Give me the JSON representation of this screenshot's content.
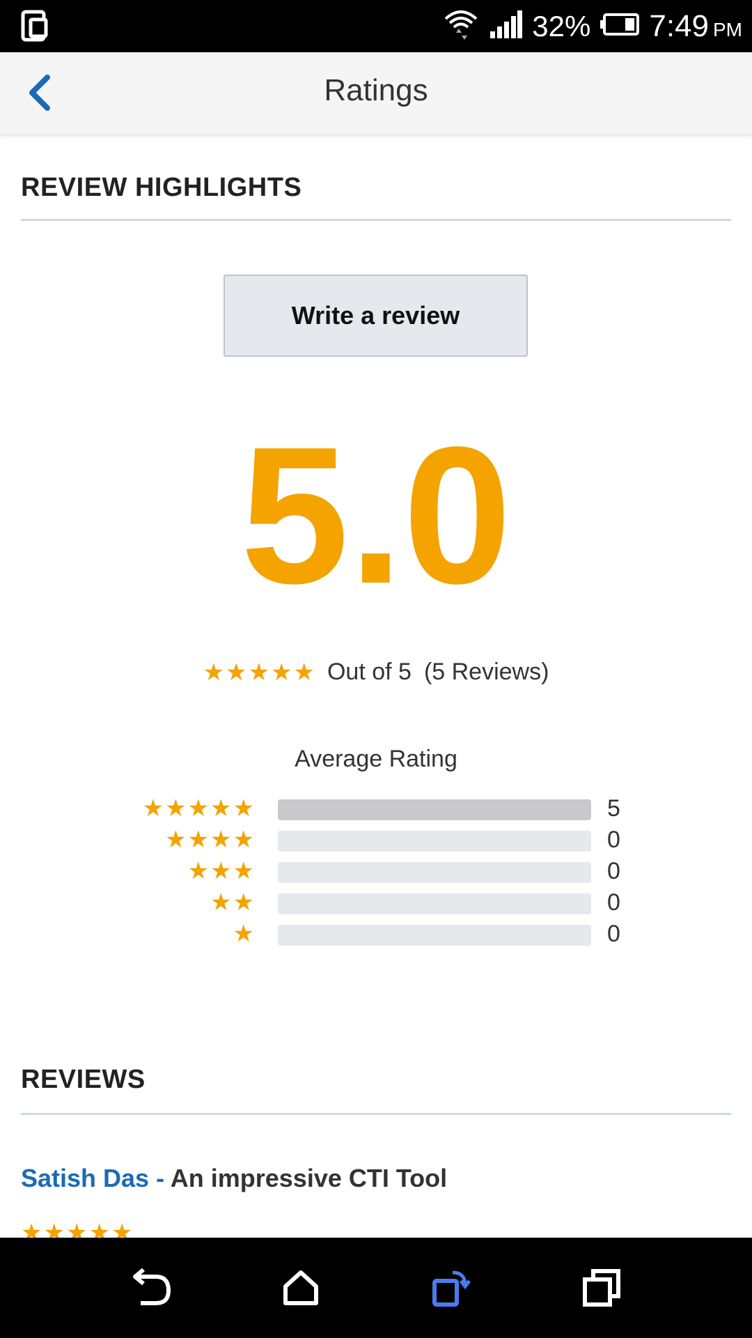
{
  "status_bar": {
    "battery": "32%",
    "time": "7:49",
    "ampm": "PM"
  },
  "app_bar": {
    "title": "Ratings"
  },
  "highlights": {
    "section_title": "REVIEW HIGHLIGHTS",
    "write_review_label": "Write a review",
    "score": "5.0",
    "out_of_text": "Out of 5",
    "reviews_count_text": "(5 Reviews)",
    "average_label": "Average Rating"
  },
  "distribution": [
    {
      "stars": 5,
      "count": "5",
      "fraction": 1.0
    },
    {
      "stars": 4,
      "count": "0",
      "fraction": 0.0
    },
    {
      "stars": 3,
      "count": "0",
      "fraction": 0.0
    },
    {
      "stars": 2,
      "count": "0",
      "fraction": 0.0
    },
    {
      "stars": 1,
      "count": "0",
      "fraction": 0.0
    }
  ],
  "reviews": {
    "section_title": "REVIEWS",
    "items": [
      {
        "author": "Satish Das -",
        "title": "An impressive CTI Tool",
        "rating": 5
      }
    ]
  },
  "colors": {
    "star": "#f4a300",
    "accent_blue": "#1c6ab5",
    "nav_active": "#4a7cf0"
  }
}
